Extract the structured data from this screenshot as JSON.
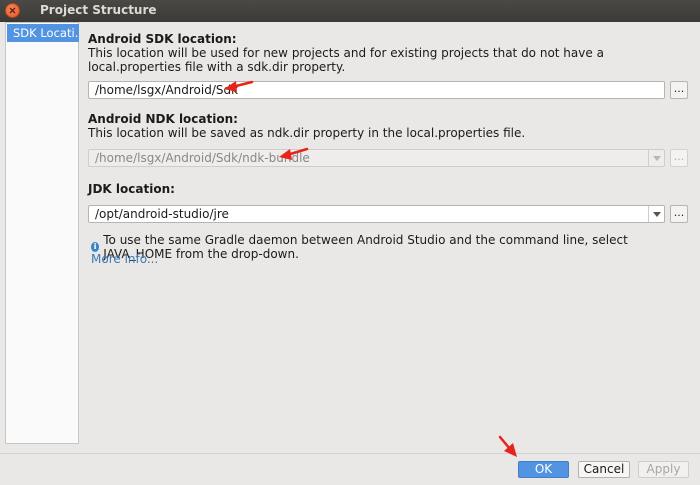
{
  "window": {
    "title": "Project Structure"
  },
  "sidebar": {
    "items": [
      {
        "label": "SDK Locati…",
        "selected": true
      }
    ]
  },
  "sdk": {
    "heading": "Android SDK location:",
    "description": "This location will be used for new projects and for existing projects that do not have a local.properties file with a sdk.dir property.",
    "path": "/home/lsgx/Android/Sdk",
    "browse_label": "..."
  },
  "ndk": {
    "heading": "Android NDK location:",
    "description": "This location will be saved as ndk.dir property in the local.properties file.",
    "path": "/home/lsgx/Android/Sdk/ndk-bundle",
    "browse_label": "..."
  },
  "jdk": {
    "heading": "JDK location:",
    "path": "/opt/android-studio/jre",
    "browse_label": "...",
    "info": "To use the same Gradle daemon between Android Studio and the command line, select JAVA_HOME from the drop-down.",
    "more_link": "More info..."
  },
  "buttons": {
    "ok": "OK",
    "cancel": "Cancel",
    "apply": "Apply"
  },
  "colors": {
    "accent": "#5294e2",
    "annotation": "#e8231a",
    "link": "#3d7ab8"
  }
}
